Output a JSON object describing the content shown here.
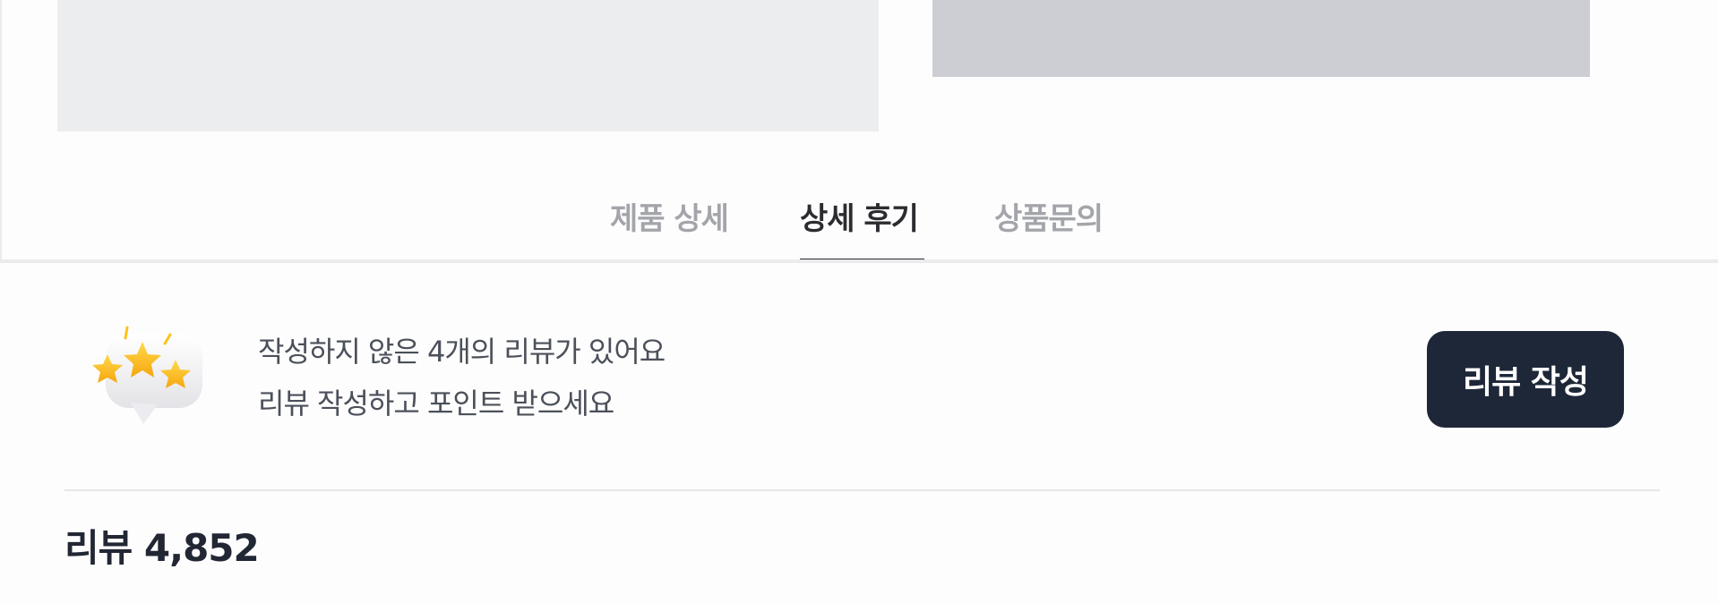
{
  "tabs": [
    {
      "label": "제품 상세",
      "active": false
    },
    {
      "label": "상세 후기",
      "active": true
    },
    {
      "label": "상품문의",
      "active": false
    }
  ],
  "review_promo": {
    "icon": "stars-speech-bubble-icon",
    "line1": "작성하지 않은 4개의 리뷰가 있어요",
    "line2": "리뷰 작성하고 포인트 받으세요",
    "button_label": "리뷰 작성"
  },
  "reviews": {
    "count_label": "리뷰 4,852"
  },
  "colors": {
    "accent_dark": "#1e2738",
    "tab_inactive": "#a3a5aa",
    "tab_active": "#2b2b30",
    "star": "#ffc21a"
  }
}
